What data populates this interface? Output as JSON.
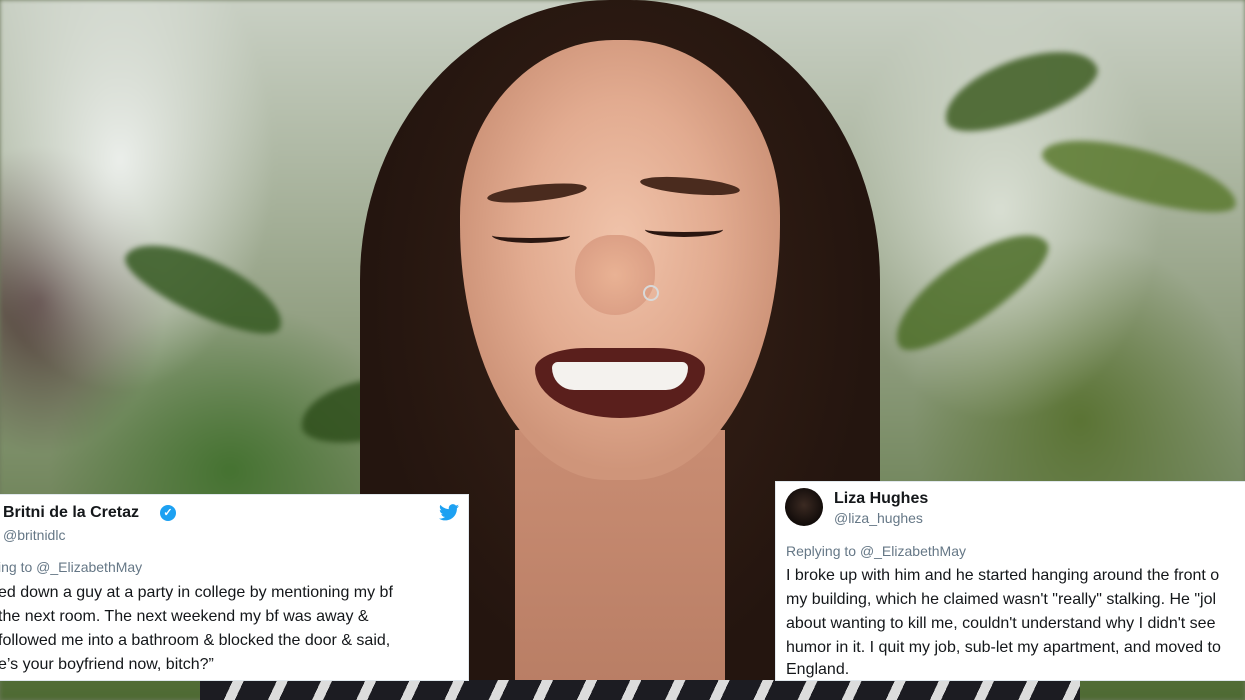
{
  "tweets": [
    {
      "name": "Britni de la Cretaz",
      "verified": true,
      "handle": "@britnidlc",
      "reply_prefix": "ing to",
      "reply_mention": "@_ElizabethMay",
      "lines": [
        "ed down a guy at a party in college by mentioning my bf",
        "the next room. The next weekend my bf was away &",
        "followed me into a bathroom & blocked the door & said,",
        "e’s your boyfriend now, bitch?”"
      ],
      "brand_icon": "twitter-bird-icon"
    },
    {
      "name": "Liza Hughes",
      "verified": false,
      "handle": "@liza_hughes",
      "reply_prefix": "Replying to",
      "reply_mention": "@_ElizabethMay",
      "lines": [
        "I broke up with him and he started hanging around the front o",
        "my building, which he claimed wasn't \"really\" stalking. He \"jol",
        "about wanting to kill me, couldn't understand why I didn't see",
        "humor in it. I quit my job, sub-let my apartment, and moved to",
        "England."
      ]
    }
  ],
  "colors": {
    "twitter_blue": "#1da1f2",
    "muted_text": "#657786"
  }
}
